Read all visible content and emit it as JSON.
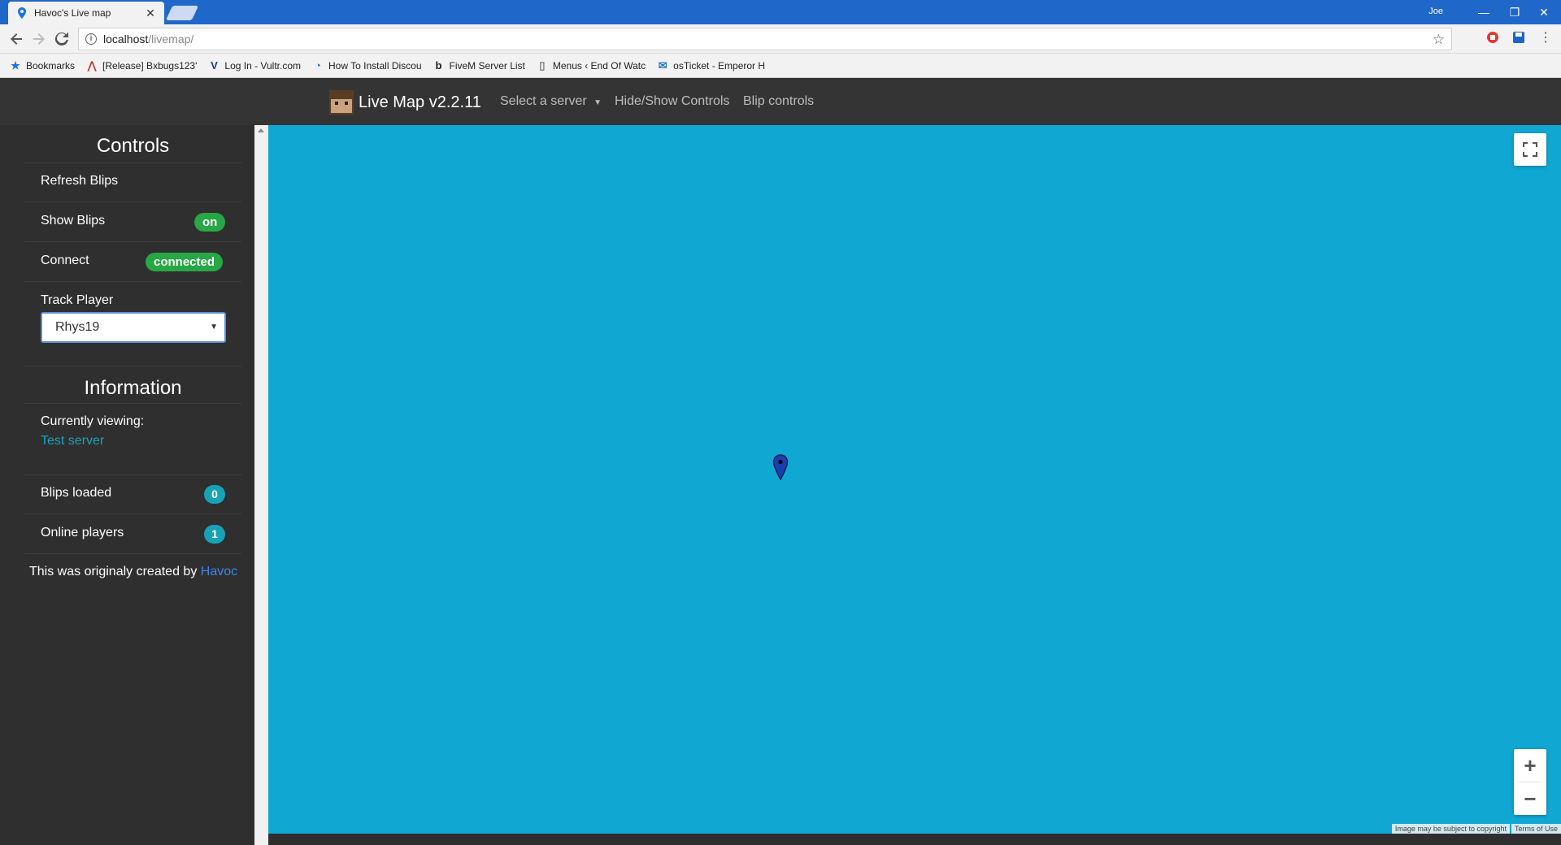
{
  "browser": {
    "tab_title": "Havoc's Live map",
    "user": "Joe",
    "url_host": "localhost",
    "url_path": "/livemap/",
    "bookmarks": [
      {
        "icon": "star-icon",
        "label": "Bookmarks"
      },
      {
        "icon": "release-icon",
        "label": "[Release] Bxbugs123'"
      },
      {
        "icon": "vultr-icon",
        "label": "Log In - Vultr.com"
      },
      {
        "icon": "discord-icon",
        "label": "How To Install Discou"
      },
      {
        "icon": "fivem-icon",
        "label": "FiveM Server List"
      },
      {
        "icon": "page-icon",
        "label": "Menus ‹ End Of Watc"
      },
      {
        "icon": "osticket-icon",
        "label": "osTicket - Emperor H"
      }
    ]
  },
  "navbar": {
    "brand": "Live Map v2.2.11",
    "select_server": "Select a server",
    "hide_show": "Hide/Show Controls",
    "blip_controls": "Blip controls"
  },
  "controls": {
    "title": "Controls",
    "refresh": "Refresh Blips",
    "show_blips": "Show Blips",
    "show_blips_state": "on",
    "connect": "Connect",
    "connect_state": "connected",
    "track_player": "Track Player",
    "track_player_value": "Rhys19"
  },
  "information": {
    "title": "Information",
    "currently_viewing": "Currently viewing:",
    "server_name": "Test server",
    "blips_loaded": "Blips loaded",
    "blips_count": "0",
    "online_players": "Online players",
    "players_count": "1",
    "credit_prefix": "This was originaly created by",
    "credit_link": "Havoc"
  },
  "map": {
    "background": "#10a7d3",
    "attribution": "Image may be subject to copyright",
    "terms": "Terms of Use"
  }
}
